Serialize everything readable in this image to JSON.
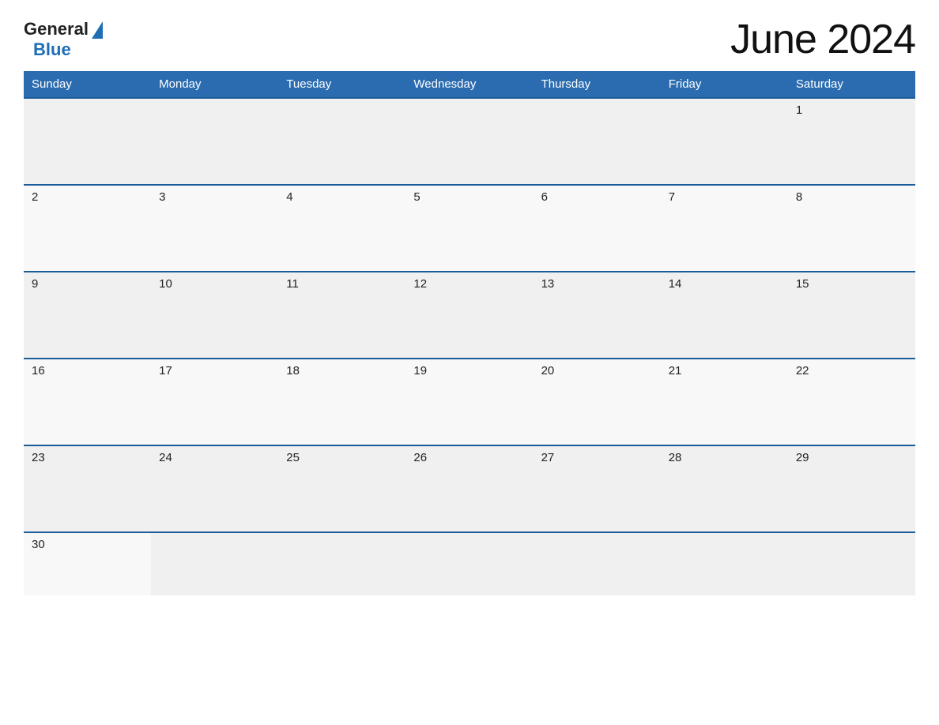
{
  "header": {
    "title": "June 2024",
    "logo": {
      "general_text": "General",
      "blue_text": "Blue"
    }
  },
  "calendar": {
    "days_of_week": [
      "Sunday",
      "Monday",
      "Tuesday",
      "Wednesday",
      "Thursday",
      "Friday",
      "Saturday"
    ],
    "weeks": [
      [
        null,
        null,
        null,
        null,
        null,
        null,
        1
      ],
      [
        2,
        3,
        4,
        5,
        6,
        7,
        8
      ],
      [
        9,
        10,
        11,
        12,
        13,
        14,
        15
      ],
      [
        16,
        17,
        18,
        19,
        20,
        21,
        22
      ],
      [
        23,
        24,
        25,
        26,
        27,
        28,
        29
      ],
      [
        30,
        null,
        null,
        null,
        null,
        null,
        null
      ]
    ]
  },
  "colors": {
    "header_bg": "#2b6cb0",
    "header_text": "#ffffff",
    "border_top": "#1a5c9a",
    "logo_blue": "#1e6eb5",
    "odd_row_bg": "#f0f0f0",
    "even_row_bg": "#f8f8f8"
  }
}
